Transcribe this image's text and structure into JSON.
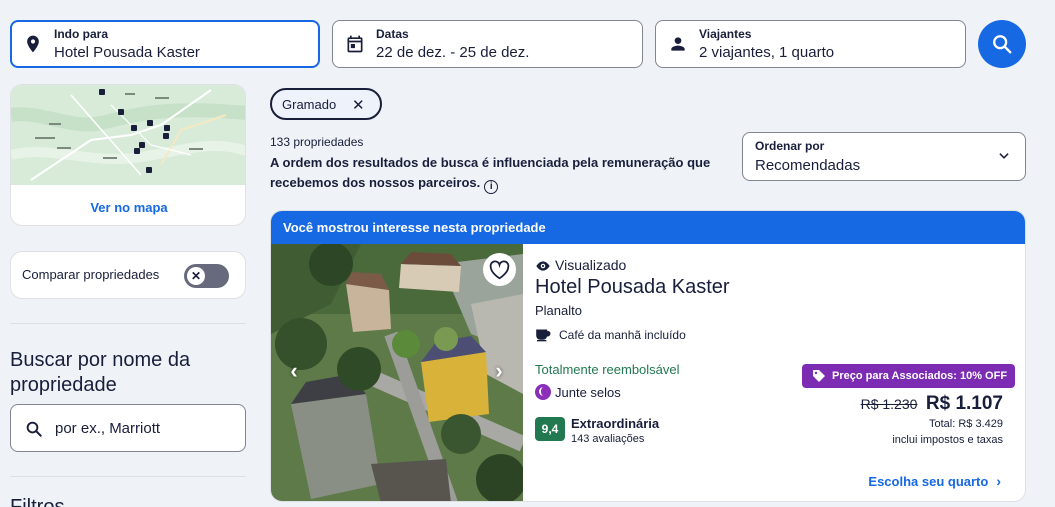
{
  "search": {
    "destination_label": "Indo para",
    "destination_value": "Hotel Pousada Kaster",
    "dates_label": "Datas",
    "dates_value": "22 de dez. - 25 de dez.",
    "travelers_label": "Viajantes",
    "travelers_value": "2 viajantes, 1 quarto"
  },
  "sidebar": {
    "map_link": "Ver no mapa",
    "compare_label": "Comparar propriedades",
    "compare_enabled": false,
    "name_search_title": "Buscar por nome da propriedade",
    "name_search_placeholder": "por ex., Marriott",
    "filters_title": "Filtros"
  },
  "results": {
    "chip": "Gramado",
    "count": "133 propriedades",
    "notice": "A ordem dos resultados de busca é influenciada pela remuneração que recebemos dos nossos parceiros.",
    "sort_label": "Ordenar por",
    "sort_value": "Recomendadas"
  },
  "listing": {
    "banner": "Você mostrou interesse nesta propriedade",
    "viewed": "Visualizado",
    "name": "Hotel Pousada Kaster",
    "location": "Planalto",
    "amenity": "Café da manhã incluído",
    "refundable": "Totalmente reembolsável",
    "stamps": "Junte selos",
    "score": "9,4",
    "rating": "Extraordinária",
    "reviews": "143 avaliações",
    "member_badge": "Preço para Associados: 10% OFF",
    "old_price": "R$ 1.230",
    "price": "R$ 1.107",
    "total": "Total: R$ 3.429",
    "taxes": "inclui impostos e taxas",
    "choose_room": "Escolha seu quarto"
  },
  "colors": {
    "brand": "#1668e3",
    "text": "#191e3b",
    "green": "#227950",
    "member_purple": "#7b2cb2",
    "background": "#eff3f7"
  }
}
